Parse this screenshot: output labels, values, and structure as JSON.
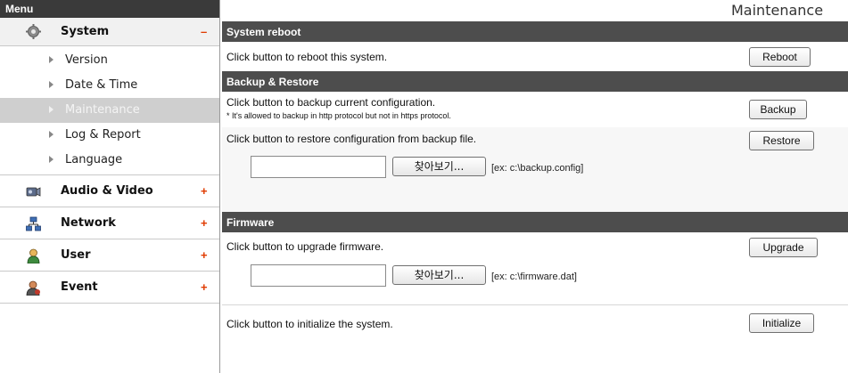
{
  "menu": {
    "header": "Menu",
    "categories": [
      {
        "label": "System",
        "toggle": "–",
        "icon": "gear-icon"
      },
      {
        "label": "Audio & Video",
        "toggle": "+",
        "icon": "camera-icon"
      },
      {
        "label": "Network",
        "toggle": "+",
        "icon": "network-icon"
      },
      {
        "label": "User",
        "toggle": "+",
        "icon": "user-icon"
      },
      {
        "label": "Event",
        "toggle": "+",
        "icon": "event-icon"
      }
    ],
    "system_items": [
      "Version",
      "Date & Time",
      "Maintenance",
      "Log & Report",
      "Language"
    ],
    "active_item": "Maintenance"
  },
  "page": {
    "title": "Maintenance"
  },
  "reboot": {
    "header": "System reboot",
    "text": "Click button to reboot this system.",
    "button": "Reboot"
  },
  "backup": {
    "header": "Backup & Restore",
    "text": "Click button to backup current configuration.",
    "note": "* It's allowed to backup in http protocol but not in https protocol.",
    "button": "Backup",
    "restore_text": "Click button to restore configuration from backup file.",
    "restore_button": "Restore",
    "browse_button": "찾아보기...",
    "hint": "[ex: c:\\backup.config]",
    "file_value": ""
  },
  "firmware": {
    "header": "Firmware",
    "text": "Click button to upgrade firmware.",
    "button": "Upgrade",
    "browse_button": "찾아보기...",
    "hint": "[ex: c:\\firmware.dat]",
    "file_value": "",
    "init_text": "Click button to initialize the system.",
    "init_button": "Initialize"
  },
  "colors": {
    "header_bg": "#4d4d4d",
    "menu_header_bg": "#3a3a3a",
    "active_item_bg": "#cfcfcf",
    "toggle": "#e03a00"
  }
}
